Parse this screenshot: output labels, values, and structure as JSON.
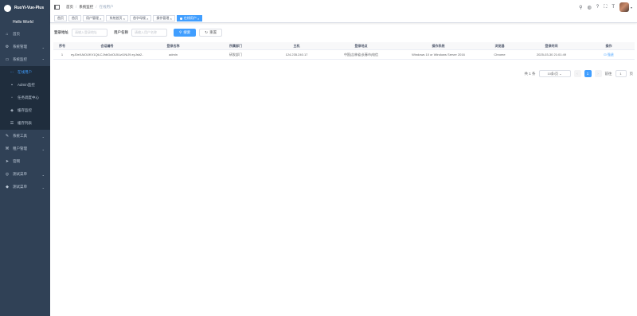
{
  "sidebar": {
    "app_title": "RuoYi-Vue-Plus",
    "greeting": "Hello World",
    "items": [
      {
        "label": "首页",
        "icon": "dashboard-icon"
      },
      {
        "label": "系统管理",
        "icon": "gear-icon"
      },
      {
        "label": "系统监控",
        "icon": "monitor-icon",
        "expanded": true
      },
      {
        "label": "系统工具",
        "icon": "tool-icon"
      },
      {
        "label": "租户管理",
        "icon": "tenant-icon"
      },
      {
        "label": "官网",
        "icon": "send-icon"
      },
      {
        "label": "测试菜单",
        "icon": "test-icon"
      },
      {
        "label": "测试菜单",
        "icon": "test-icon"
      }
    ],
    "submenu": [
      {
        "label": "在线用户",
        "active": true
      },
      {
        "label": "Admin监控"
      },
      {
        "label": "任务调度中心"
      },
      {
        "label": "缓存监控"
      },
      {
        "label": "缓存列表"
      }
    ]
  },
  "navbar": {
    "breadcrumb": [
      "首页",
      "系统监控",
      "在线用户"
    ]
  },
  "tags": [
    {
      "label": "首页"
    },
    {
      "label": "首页"
    },
    {
      "label": "用户管理"
    },
    {
      "label": "系统首页"
    },
    {
      "label": "首字母搜"
    },
    {
      "label": "操作管理"
    },
    {
      "label": "在线用户",
      "active": true
    }
  ],
  "search": {
    "ip_label": "登录地址",
    "ip_placeholder": "请输入登录地址",
    "user_label": "用户名称",
    "user_placeholder": "请输入用户名称",
    "search_button": "搜索",
    "reset_button": "重置"
  },
  "table": {
    "headers": [
      "序号",
      "会话编号",
      "登录名称",
      "所属部门",
      "主机",
      "登录地点",
      "操作系统",
      "浏览器",
      "登录时间",
      "操作"
    ],
    "rows": [
      [
        "1",
        "eyJ0eXAiOiJKV1QiLCJhbGciOiJIUzI1NiJ9.eyJsb2...",
        "admin",
        "研发部门",
        "124.235.240.17",
        "中国|吉林省|长春市|电信",
        "Windows 10 or Windows Server 2016",
        "Chrome",
        "2025-03-30 21:01:49",
        "强退"
      ]
    ]
  },
  "pagination": {
    "total": "共 1 条",
    "page_size": "10条/页",
    "current": "1",
    "goto_label": "前往",
    "goto_value": "1",
    "page_unit": "页"
  },
  "colors": {
    "sidebar_bg": "#304156",
    "primary": "#409eff"
  }
}
